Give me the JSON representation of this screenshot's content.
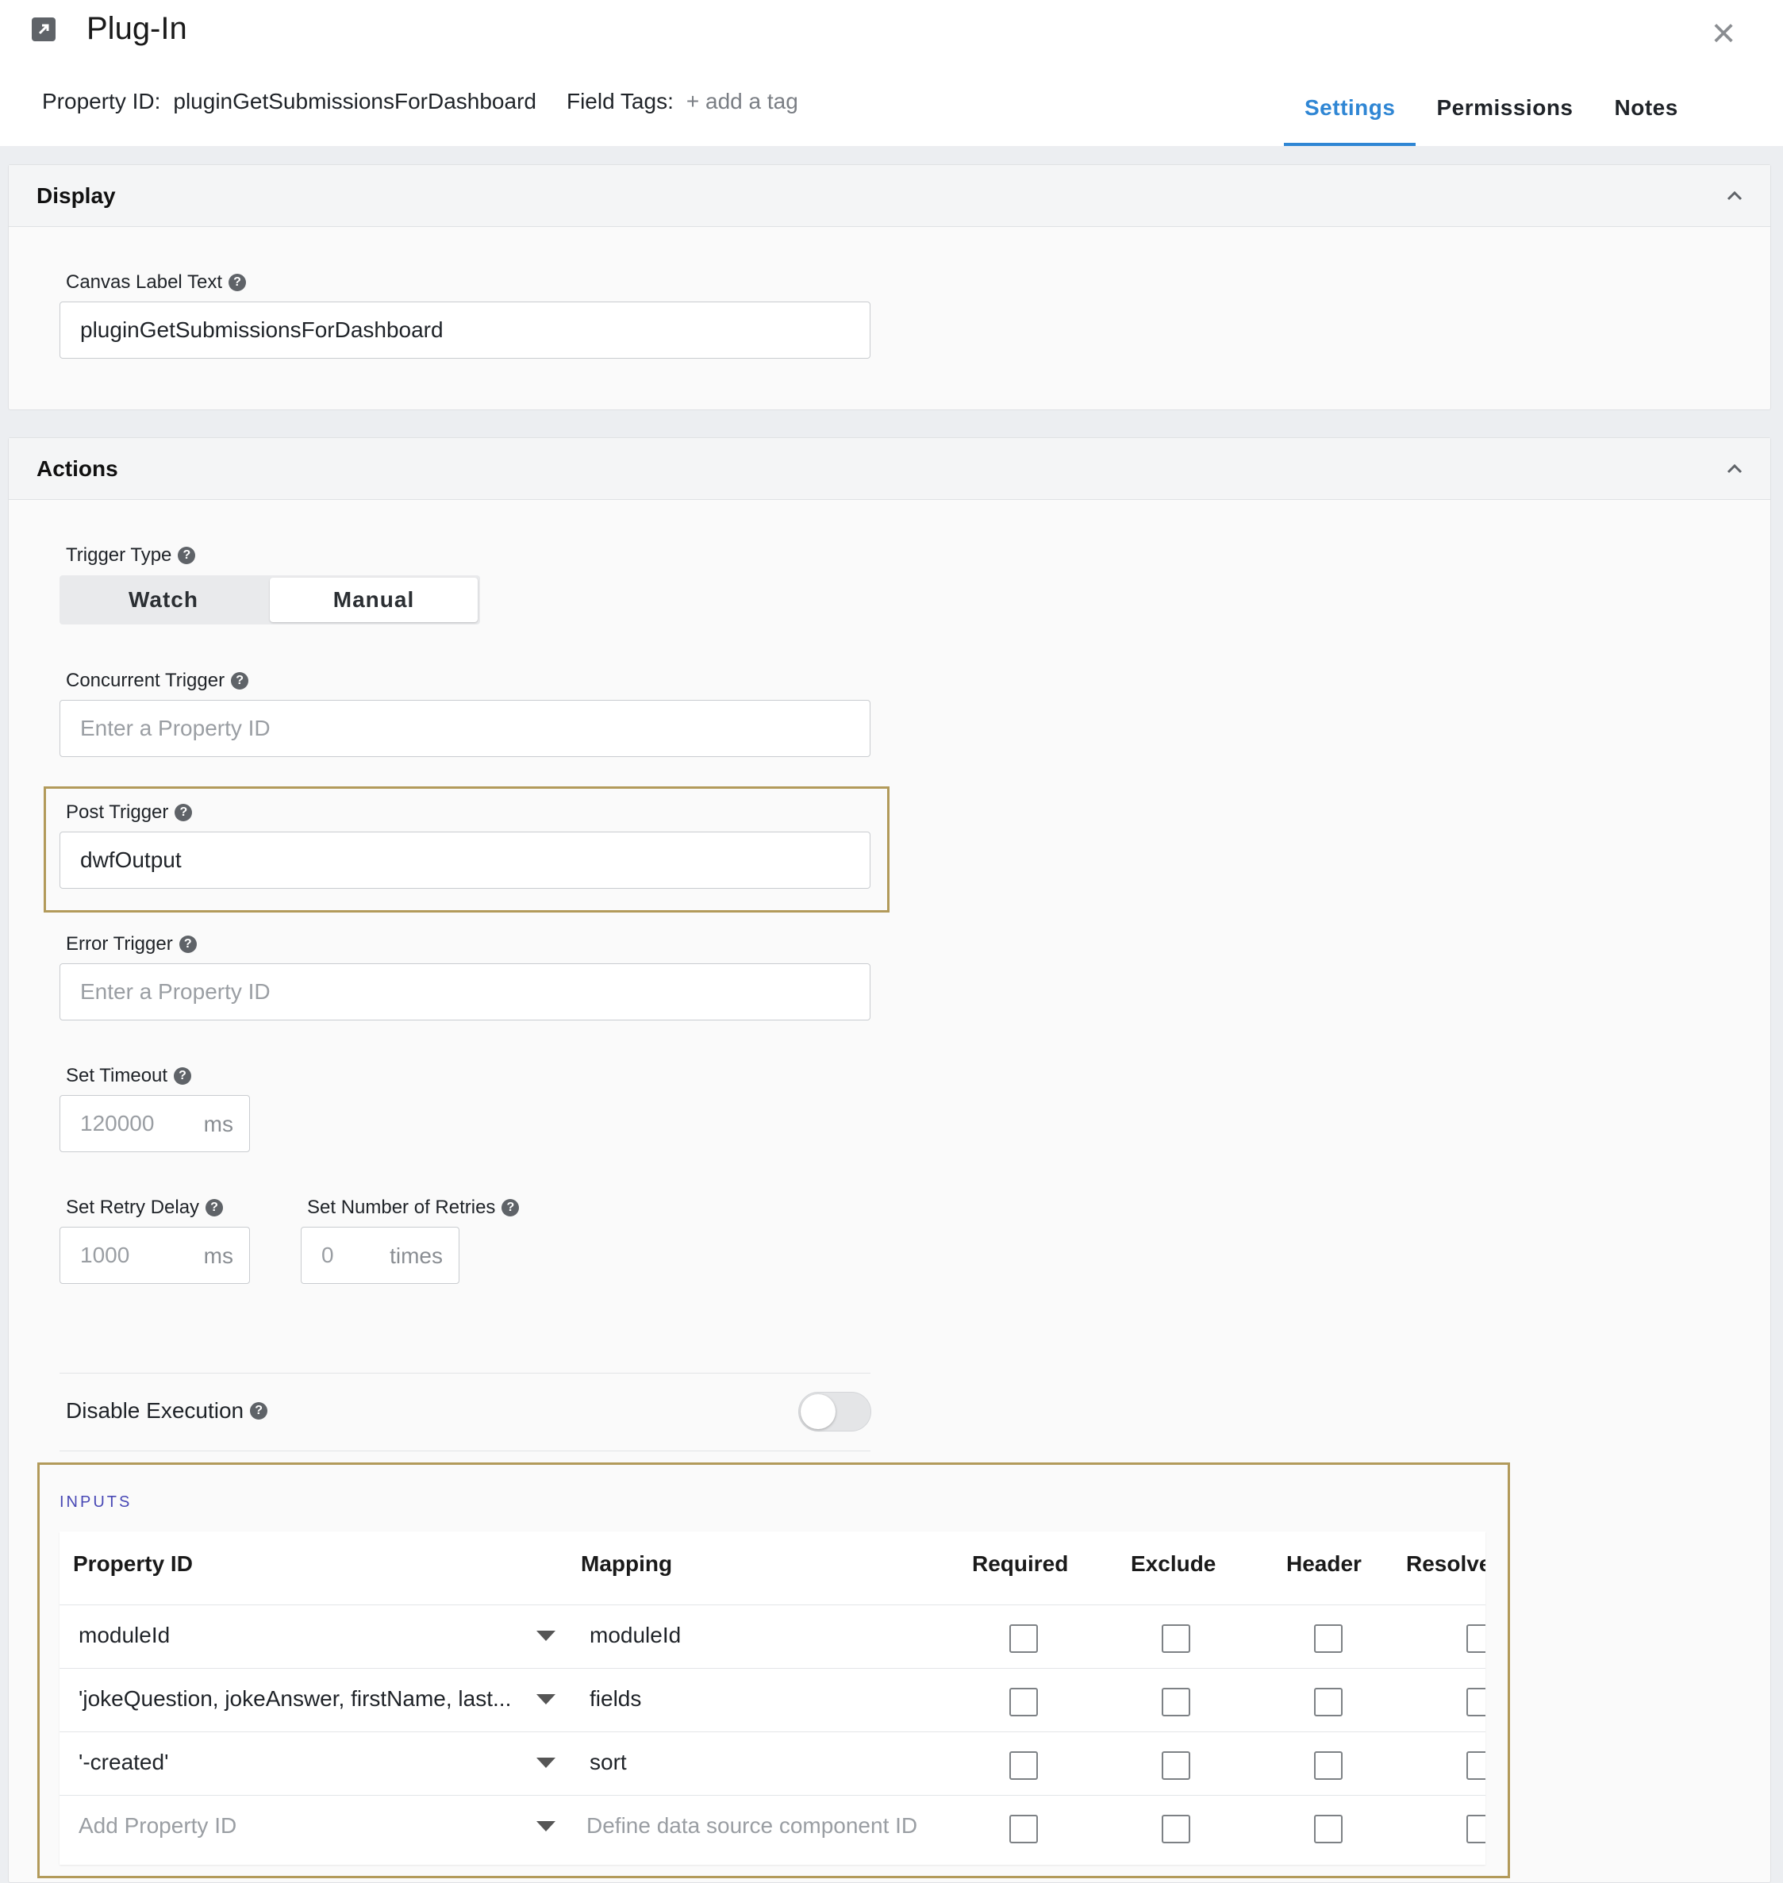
{
  "header": {
    "title": "Plug-In",
    "property_id_label": "Property ID:",
    "property_id_value": "pluginGetSubmissionsForDashboard",
    "field_tags_label": "Field Tags:",
    "add_tag": "+ add a tag",
    "tabs": [
      {
        "label": "Settings",
        "active": true
      },
      {
        "label": "Permissions",
        "active": false
      },
      {
        "label": "Notes",
        "active": false
      }
    ],
    "close_icon": "close-icon",
    "header_icon": "external-link-icon"
  },
  "display": {
    "title": "Display",
    "canvas_label_text_label": "Canvas Label Text",
    "canvas_label_text_value": "pluginGetSubmissionsForDashboard"
  },
  "actions": {
    "title": "Actions",
    "trigger_type_label": "Trigger Type",
    "trigger_options": [
      "Watch",
      "Manual"
    ],
    "trigger_selected": "Manual",
    "concurrent_trigger_label": "Concurrent Trigger",
    "concurrent_trigger_placeholder": "Enter a Property ID",
    "post_trigger_label": "Post Trigger",
    "post_trigger_value": "dwfOutput",
    "error_trigger_label": "Error Trigger",
    "error_trigger_placeholder": "Enter a Property ID",
    "set_timeout_label": "Set Timeout",
    "set_timeout_placeholder": "120000",
    "set_timeout_unit": "ms",
    "retry_delay_label": "Set Retry Delay",
    "retry_delay_placeholder": "1000",
    "retry_delay_unit": "ms",
    "retries_label": "Set Number of Retries",
    "retries_placeholder": "0",
    "retries_unit": "times",
    "disable_execution_label": "Disable Execution",
    "disable_execution_on": false
  },
  "inputs": {
    "section_label": "INPUTS",
    "columns": [
      "Property ID",
      "Mapping",
      "Required",
      "Exclude",
      "Header",
      "Resolve"
    ],
    "rows": [
      {
        "property_id": "moduleId",
        "mapping": "moduleId"
      },
      {
        "property_id": "'jokeQuestion, jokeAnswer, firstName, last...",
        "mapping": "fields"
      },
      {
        "property_id": "'-created'",
        "mapping": "sort"
      }
    ],
    "new_row": {
      "property_placeholder": "Add Property ID",
      "mapping_placeholder": "Define data source component ID"
    }
  },
  "colors": {
    "accent": "#2f86d4",
    "highlight_border": "#b29a5a",
    "inputs_label": "#4848b5"
  }
}
